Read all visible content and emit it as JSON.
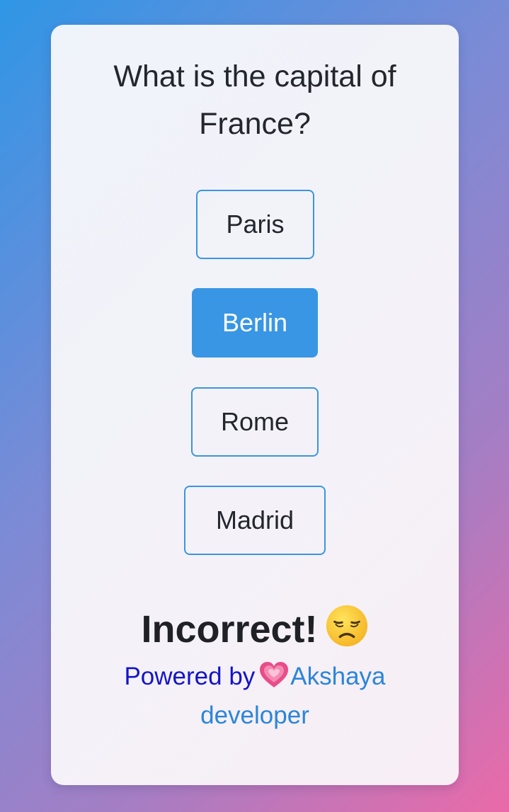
{
  "quiz": {
    "question": "What is the capital of France?",
    "options": [
      {
        "label": "Paris",
        "selected": false
      },
      {
        "label": "Berlin",
        "selected": true
      },
      {
        "label": "Rome",
        "selected": false
      },
      {
        "label": "Madrid",
        "selected": false
      }
    ],
    "result_text": "Incorrect!",
    "result_icon": "disappointed-face-icon"
  },
  "footer": {
    "powered_by": "Powered by",
    "heart_icon": "growing-heart-icon",
    "author": "Akshaya developer"
  },
  "colors": {
    "accent": "#3996e4",
    "powered_text": "#1414c8",
    "author_link": "#2c85d8"
  }
}
